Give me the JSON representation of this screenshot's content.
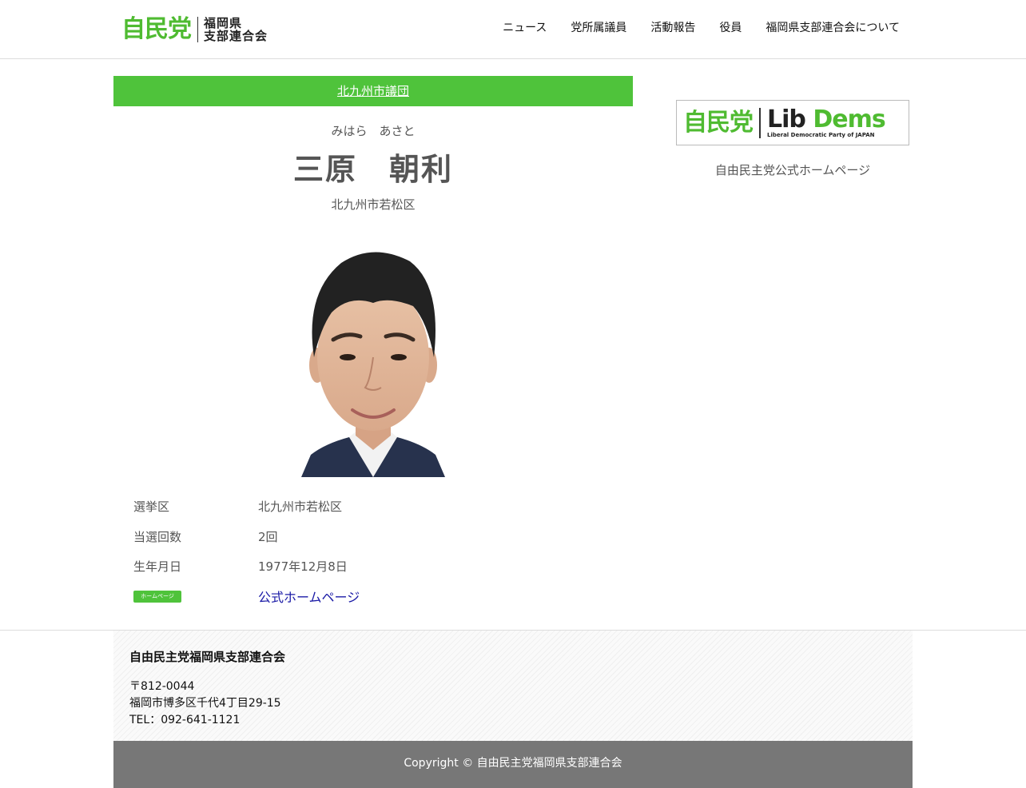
{
  "header": {
    "logo": {
      "main": "自民党",
      "sub_line1": "福岡県",
      "sub_line2": "支部連合会"
    },
    "nav": [
      {
        "label": "ニュース"
      },
      {
        "label": "党所属議員"
      },
      {
        "label": "活動報告"
      },
      {
        "label": "役員"
      },
      {
        "label": "福岡県支部連合会について"
      }
    ]
  },
  "main": {
    "group_link": "北九州市議団",
    "kana": "みはら　あさと",
    "name": "三原　朝利",
    "district": "北九州市若松区",
    "profile": [
      {
        "label": "選挙区",
        "value": "北九州市若松区"
      },
      {
        "label": "当選回数",
        "value": "2回"
      },
      {
        "label": "生年月日",
        "value": "1977年12月8日"
      }
    ],
    "homepage": {
      "badge": "ホームページ",
      "link_text": "公式ホームページ"
    }
  },
  "sidebar": {
    "banner": {
      "ldp": "自民党",
      "libdems_lib": "Lib",
      "libdems_dems": "Dems",
      "libdems_sub": "Liberal Democratic Party of JAPAN"
    },
    "caption": "自由民主党公式ホームページ"
  },
  "footer": {
    "org_name": "自由民主党福岡県支部連合会",
    "postal": "〒812-0044",
    "address": "福岡市博多区千代4丁目29-15",
    "tel": "TEL：092-641-1121",
    "copyright": "Copyright © 自由民主党福岡県支部連合会"
  },
  "colors": {
    "brand_green": "#4fc33b",
    "link_blue": "#1a1aa6",
    "footer_gray": "#777777"
  }
}
